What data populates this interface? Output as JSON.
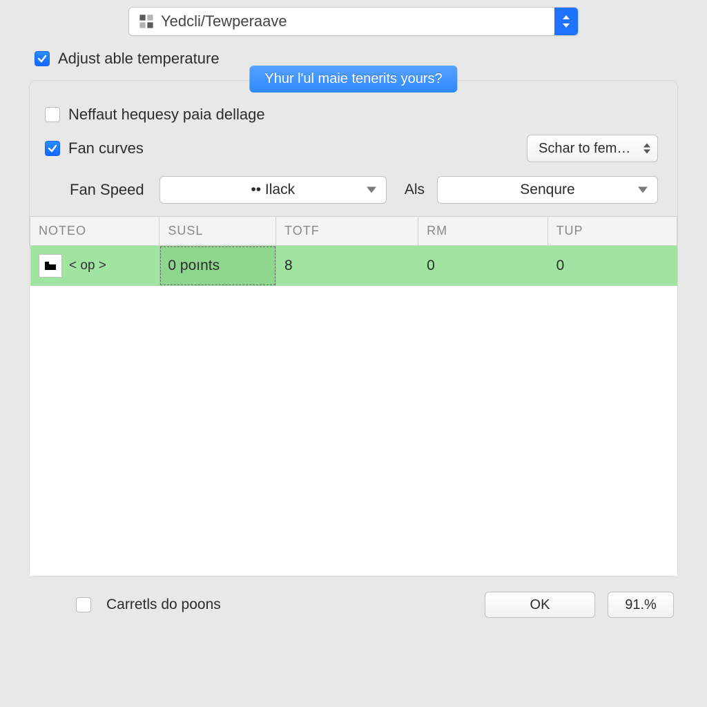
{
  "top_select": {
    "label": "Yedcli/Tewperaave"
  },
  "checkboxes": {
    "adjust_temp": {
      "checked": true,
      "label": "Adjust able temperature"
    },
    "neffaut": {
      "checked": false,
      "label": "Neffaut hequesy paia dellage"
    },
    "fan_curves": {
      "checked": true,
      "label": "Fan curves"
    },
    "carretls": {
      "checked": false,
      "label": "Carretls do poons"
    }
  },
  "group_tab_label": "Yhur l'ul maie tenerits yours?",
  "schar_select": {
    "label": "Schar to fem…"
  },
  "fan_speed": {
    "label": "Fan Speed",
    "value": "•• Ilack"
  },
  "als": {
    "label": "Als",
    "value": "Senqure"
  },
  "table": {
    "headers": [
      "NOTEO",
      "SUSL",
      "TOTF",
      "RM",
      "TUP"
    ],
    "rows": [
      {
        "noteo_op": "< op >",
        "susl": "0 poınts",
        "totf": "8",
        "rm": "0",
        "tup": "0"
      }
    ]
  },
  "buttons": {
    "ok": "OK",
    "percent": "91.%"
  }
}
